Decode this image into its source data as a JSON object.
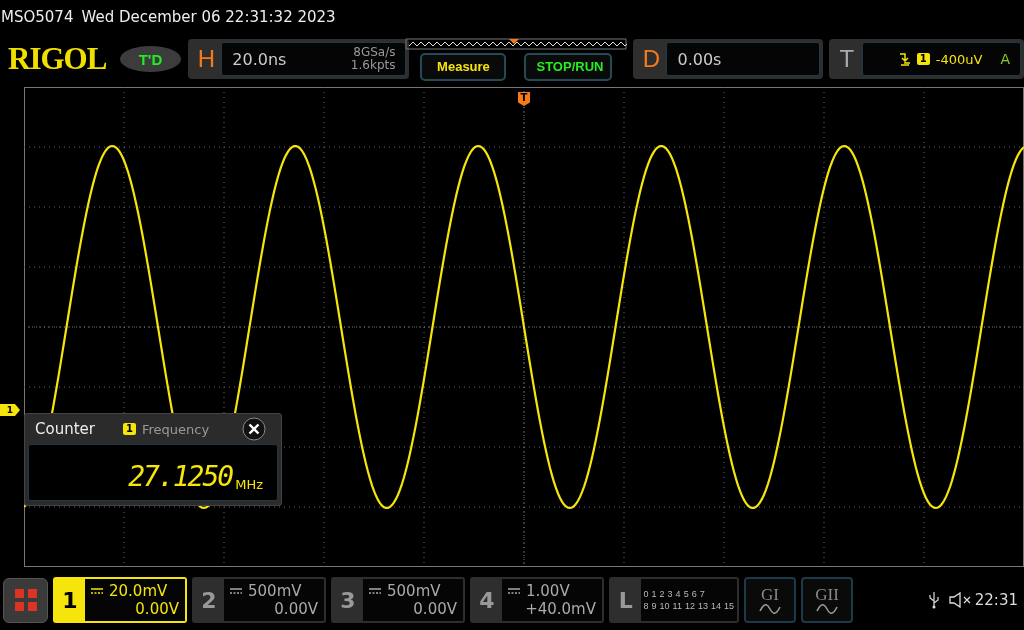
{
  "header": {
    "model": "MSO5074",
    "datetime": "Wed December 06 22:31:32 2023"
  },
  "toolbar": {
    "logo": "RIGOL",
    "mode_badge": "T'D",
    "horizontal": {
      "letter": "H",
      "timebase": "20.0ns",
      "sample_rate": "8GSa/s",
      "memory_depth": "1.6kpts"
    },
    "buttons": [
      {
        "label": "Measure",
        "kind": "measure"
      },
      {
        "label": "STOP/RUN",
        "kind": "run"
      }
    ],
    "delay": {
      "letter": "D",
      "value": "0.00s"
    },
    "trigger": {
      "letter": "T",
      "source": "1",
      "level": "-400uV",
      "mode": "A"
    }
  },
  "display": {
    "trigger_marker": "T",
    "channel_marker": "1",
    "counter": {
      "title": "Counter",
      "source": "1",
      "measurement": "Frequency",
      "value": "27.1250",
      "unit": "MHz"
    }
  },
  "bottom_bar": {
    "channels": [
      {
        "number": "1",
        "scale": "20.0mV",
        "offset": "0.00V",
        "selected": true
      },
      {
        "number": "2",
        "scale": "500mV",
        "offset": "0.00V",
        "selected": false
      },
      {
        "number": "3",
        "scale": "500mV",
        "offset": "0.00V",
        "selected": false
      },
      {
        "number": "4",
        "scale": "1.00V",
        "offset": "+40.0mV",
        "selected": false
      }
    ],
    "logic": {
      "letter": "L",
      "row_1": [
        "0",
        "1",
        "2",
        "3",
        "4",
        "5",
        "6",
        "7"
      ],
      "row_2": [
        "8",
        "9",
        "10",
        "11",
        "12",
        "13",
        "14",
        "15"
      ]
    },
    "math": [
      {
        "label": "GI"
      },
      {
        "label": "GII"
      }
    ],
    "clock": "22:31"
  }
}
